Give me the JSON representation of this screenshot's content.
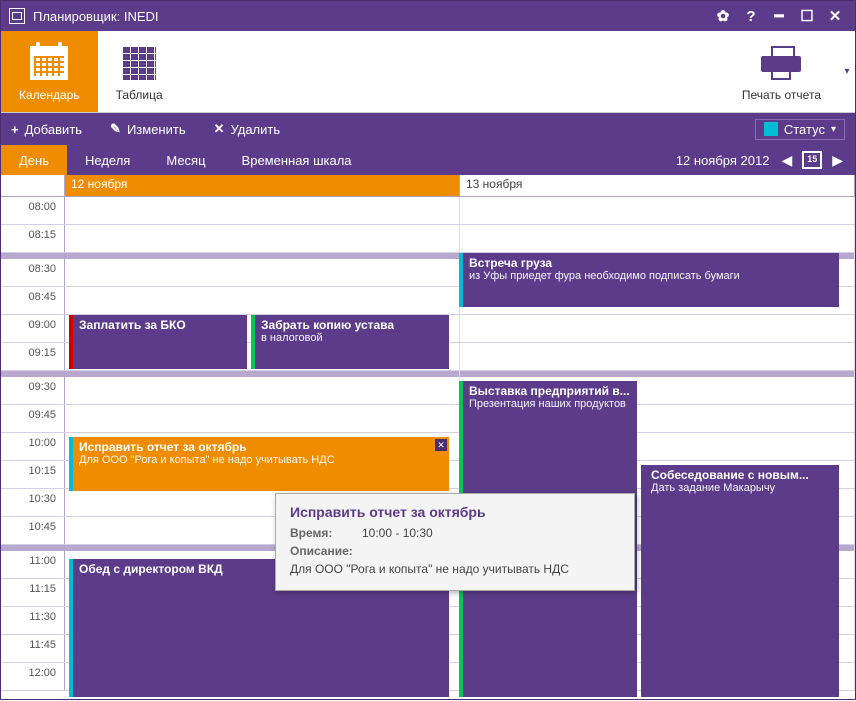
{
  "title": "Планировщик: INEDI",
  "ribbon": {
    "calendar": "Календарь",
    "table": "Таблица",
    "print": "Печать отчета"
  },
  "toolbar": {
    "add": "Добавить",
    "edit": "Изменить",
    "delete": "Удалить",
    "status": "Статус"
  },
  "views": {
    "day": "День",
    "week": "Неделя",
    "month": "Месяц",
    "timeline": "Временная шкала",
    "current_date": "12 ноября 2012"
  },
  "days": {
    "d1": "12 ноября",
    "d2": "13 ноября"
  },
  "times": [
    "08:00",
    "08:15",
    "08:30",
    "08:45",
    "09:00",
    "09:15",
    "09:30",
    "09:45",
    "10:00",
    "10:15",
    "10:30",
    "10:45",
    "11:00",
    "11:15",
    "11:30",
    "11:45",
    "12:00"
  ],
  "events": {
    "e1": {
      "title": "Заплатить за БКО",
      "desc": "",
      "color": "#d40000"
    },
    "e2": {
      "title": "Забрать копию устава",
      "desc": "в налоговой",
      "color": "#00c853"
    },
    "e3": {
      "title": "Исправить отчет за октябрь",
      "desc": "Для ООО \"Рога и копыта\" не надо учитывать НДС",
      "color": "#00bcd4"
    },
    "e4": {
      "title": "Обед с директором ВКД",
      "desc": "",
      "color": "#00bcd4"
    },
    "e5": {
      "title": "Встреча груза",
      "desc": "из Уфы приедет фура необходимо подписать бумаги",
      "color": "#00bcd4"
    },
    "e6": {
      "title": "Выставка предприятий в...",
      "desc": "Презентация наших продуктов",
      "color": "#00c853"
    },
    "e7": {
      "title": "Собеседование с новым...",
      "desc": "Дать задание Макарычу",
      "color": "#5c3c8a"
    }
  },
  "tooltip": {
    "title": "Исправить отчет за октябрь",
    "time_label": "Время:",
    "time_value": "10:00 - 10:30",
    "desc_label": "Описание:",
    "desc_value": "Для ООО \"Рога и копыта\" не надо учитывать НДС"
  }
}
